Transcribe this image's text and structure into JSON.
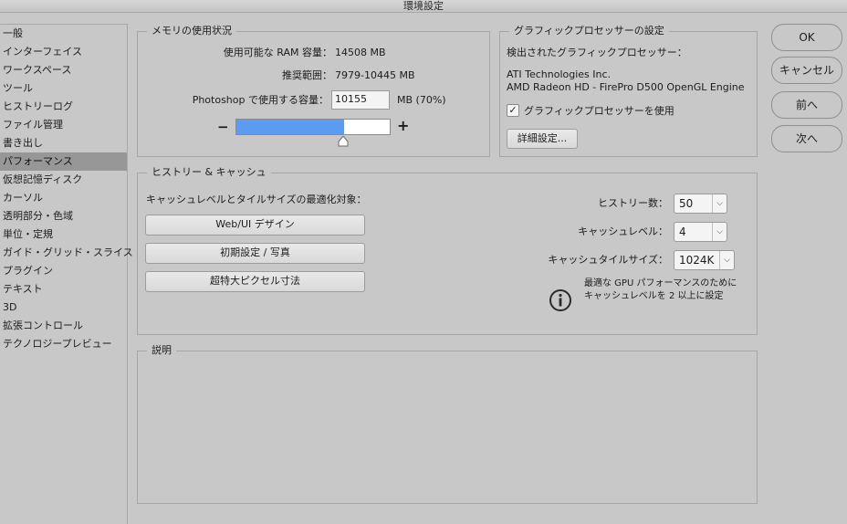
{
  "window": {
    "title": "環境設定"
  },
  "sidebar": {
    "selected_index": 8,
    "items": [
      {
        "label": "一般"
      },
      {
        "label": "インターフェイス"
      },
      {
        "label": "ワークスペース"
      },
      {
        "label": "ツール"
      },
      {
        "label": "ヒストリーログ"
      },
      {
        "label": "ファイル管理"
      },
      {
        "label": "書き出し"
      },
      {
        "label": "パフォーマンス"
      },
      {
        "label": "仮想記憶ディスク"
      },
      {
        "label": "カーソル"
      },
      {
        "label": "透明部分・色域"
      },
      {
        "label": "単位・定規"
      },
      {
        "label": "ガイド・グリッド・スライス"
      },
      {
        "label": "プラグイン"
      },
      {
        "label": "テキスト"
      },
      {
        "label": "3D"
      },
      {
        "label": "拡張コントロール"
      },
      {
        "label": "テクノロジープレビュー"
      }
    ]
  },
  "memory": {
    "title": "メモリの使用状況",
    "available_label": "使用可能な RAM 容量：",
    "available_value": "14508 MB",
    "range_label": "推奨範囲：",
    "range_value": "7979-10445 MB",
    "use_label": "Photoshop で使用する容量：",
    "use_value": "10155",
    "use_unit": "MB (70%)",
    "minus": "−",
    "plus": "+",
    "slider_percent": 70
  },
  "gpu": {
    "title": "グラフィックプロセッサーの設定",
    "detected_label": "検出されたグラフィックプロセッサー：",
    "vendor": "ATI Technologies Inc.",
    "model": "AMD Radeon HD - FirePro D500 OpenGL Engine",
    "use_gpu_label": "グラフィックプロセッサーを使用",
    "use_gpu_checked": true,
    "check_mark": "✓",
    "advanced_button": "詳細設定..."
  },
  "history_cache": {
    "title": "ヒストリー & キャッシュ",
    "optimize_label": "キャッシュレベルとタイルサイズの最適化対象：",
    "buttons": [
      "Web/UI デザイン",
      "初期設定 / 写真",
      "超特大ピクセル寸法"
    ],
    "history_states_label": "ヒストリー数：",
    "history_states_value": "50",
    "cache_levels_label": "キャッシュレベル：",
    "cache_levels_value": "4",
    "tile_size_label": "キャッシュタイルサイズ：",
    "tile_size_value": "1024K",
    "info_line1": "最適な GPU パフォーマンスのために",
    "info_line2": "キャッシュレベルを 2 以上に設定"
  },
  "description": {
    "title": "説明"
  },
  "actions": {
    "ok": "OK",
    "cancel": "キャンセル",
    "prev": "前へ",
    "next": "次へ"
  }
}
